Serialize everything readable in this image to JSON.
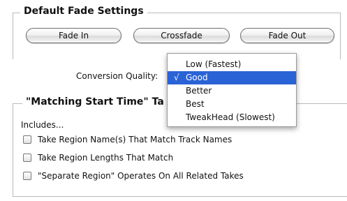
{
  "fade_settings": {
    "title": "Default Fade Settings",
    "buttons": {
      "fade_in": "Fade In",
      "crossfade": "Crossfade",
      "fade_out": "Fade Out"
    }
  },
  "conversion_quality": {
    "label": "Conversion Quality:",
    "selected": "Good",
    "checkmark": "√",
    "options": [
      "Low (Fastest)",
      "Good",
      "Better",
      "Best",
      "TweakHead (Slowest)"
    ]
  },
  "matching_start_time": {
    "title": "\"Matching Start Time\" Ta",
    "includes_label": "Includes...",
    "checkboxes": [
      {
        "label": "Take Region Name(s) That Match Track Names",
        "checked": false
      },
      {
        "label": "Take Region Lengths That Match",
        "checked": false
      },
      {
        "label": "\"Separate Region\" Operates On All Related Takes",
        "checked": false
      }
    ]
  },
  "colors": {
    "menu_highlight": "#2a63d6",
    "group_border": "#b9b9b9"
  }
}
